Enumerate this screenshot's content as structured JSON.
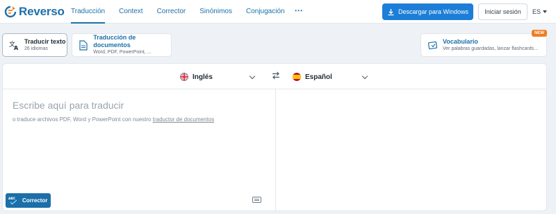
{
  "header": {
    "logo_text": "Reverso",
    "nav": [
      {
        "label": "Traducción",
        "active": true
      },
      {
        "label": "Context",
        "active": false
      },
      {
        "label": "Corrector",
        "active": false
      },
      {
        "label": "Sinónimos",
        "active": false
      },
      {
        "label": "Conjugación",
        "active": false
      }
    ],
    "more_icon": "⋯",
    "download_label": "Descargar para Windows",
    "login_label": "Iniciar sesión",
    "ui_language": "ES"
  },
  "modes": {
    "text": {
      "title": "Traducir texto",
      "subtitle": "26 idiomas"
    },
    "documents": {
      "title": "Traducción de documentos",
      "subtitle": "Word, PDF, PowerPoint, ..."
    },
    "vocabulary": {
      "title": "Vocabulario",
      "subtitle": "Ver palabras guardadas, lanzar flashcards...",
      "badge": "NEW"
    }
  },
  "translator": {
    "source_language": "Inglés",
    "target_language": "Español",
    "placeholder": "Escribe aquí para traducir",
    "hint_text": "o traduce archivos PDF, Word y PowerPoint con nuestro ",
    "hint_link": "traductor de documentos",
    "corrector_label": "Corrector"
  },
  "colors": {
    "brand": "#1c6fa8",
    "accent": "#1c7ed6",
    "badge": "#f07d1f"
  }
}
